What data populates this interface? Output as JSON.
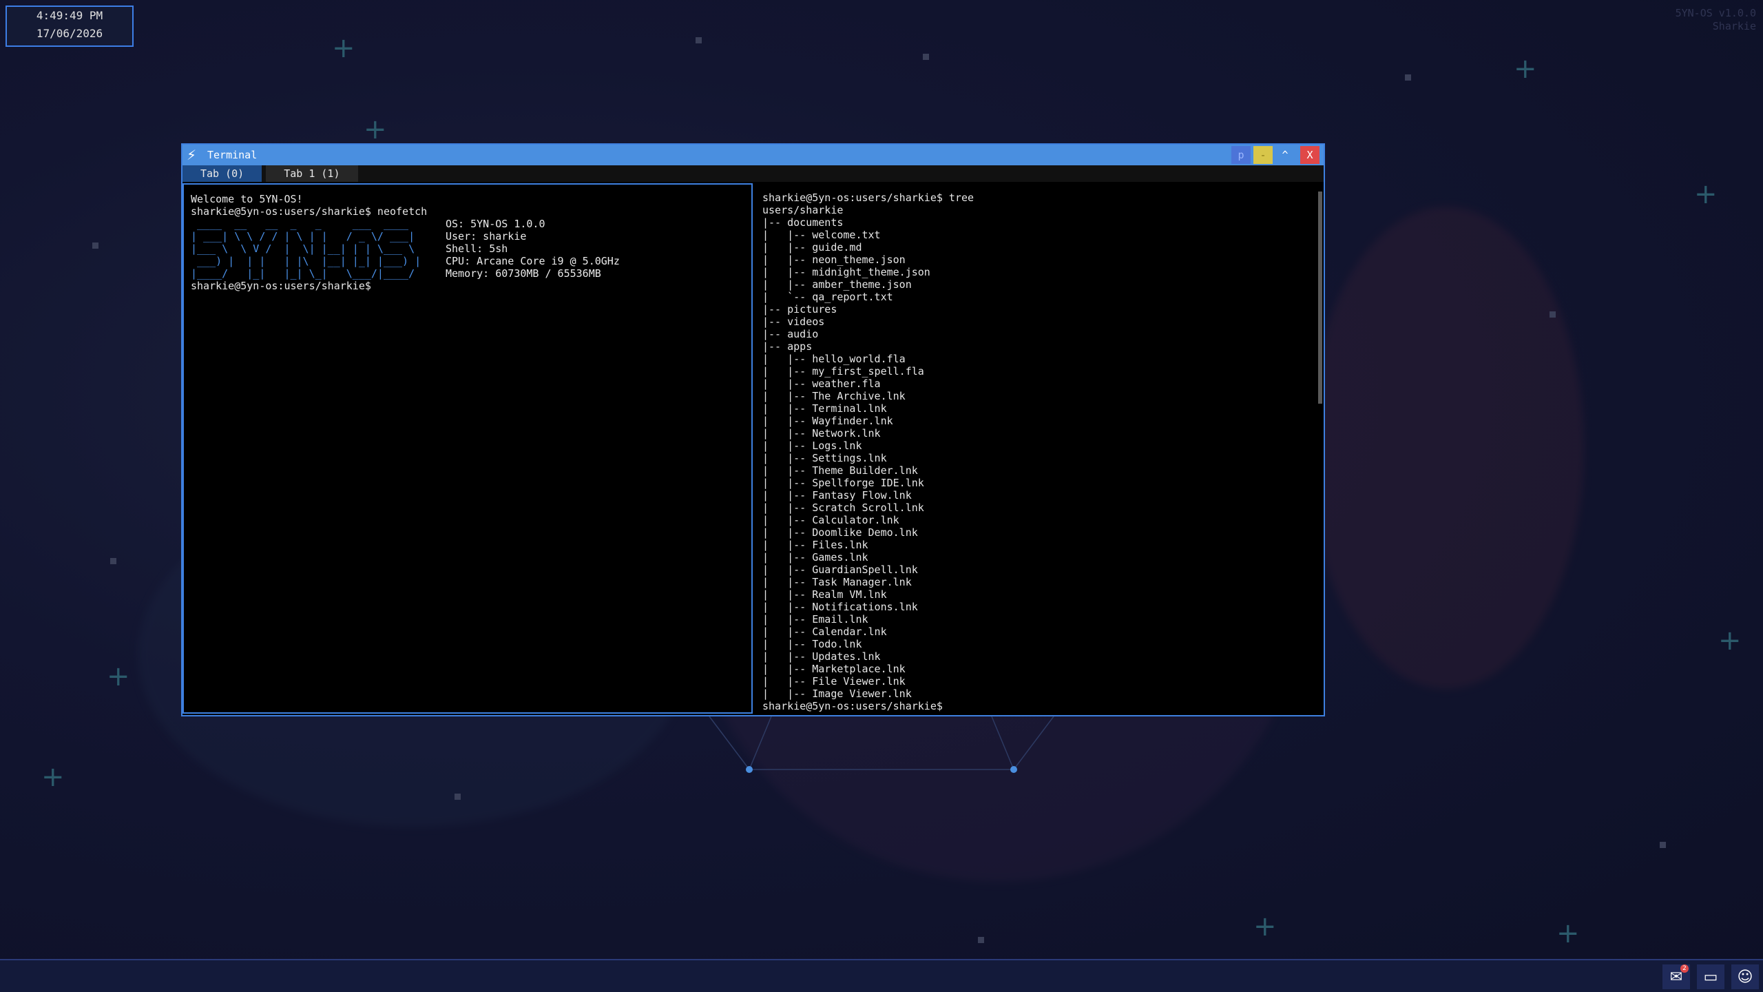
{
  "clock": {
    "time": "4:49:49 PM",
    "date": "17/06/2026"
  },
  "system": {
    "version": "5YN-OS v1.0.0",
    "user": "Sharkie"
  },
  "window": {
    "title": "Terminal",
    "icon": "lightning-icon",
    "buttons": {
      "p": "p",
      "minimize": "-",
      "maximize": "^",
      "close": "X"
    },
    "tabs": [
      {
        "label": "Tab (0)",
        "active": true
      },
      {
        "label": "Tab 1 (1)",
        "active": false
      }
    ]
  },
  "left_pane": {
    "welcome": "Welcome to 5YN-OS!",
    "command": "sharkie@5yn-os:users/sharkie$ neofetch",
    "ascii_art": [
      " ____  __   __  _   _     ___  ____",
      "| ___| \\ \\ / / | \\ | |   / _ \\/ ___|",
      "|___ \\  \\ V /  |  \\| |__| | | \\___ \\",
      " ___) |  | |   | |\\  |__| |_| |___) |",
      "|____/   |_|   |_| \\_|   \\___/|____/"
    ],
    "info": [
      "OS: 5YN-OS 1.0.0",
      "User: sharkie",
      "Shell: 5sh",
      "CPU: Arcane Core i9 @ 5.0GHz",
      "Memory: 60730MB / 65536MB"
    ],
    "prompt": "sharkie@5yn-os:users/sharkie$"
  },
  "right_pane": {
    "lines": [
      "sharkie@5yn-os:users/sharkie$ tree",
      "users/sharkie",
      "|-- documents",
      "|   |-- welcome.txt",
      "|   |-- guide.md",
      "|   |-- neon_theme.json",
      "|   |-- midnight_theme.json",
      "|   |-- amber_theme.json",
      "|   `-- qa_report.txt",
      "|-- pictures",
      "|-- videos",
      "|-- audio",
      "|-- apps",
      "|   |-- hello_world.fla",
      "|   |-- my_first_spell.fla",
      "|   |-- weather.fla",
      "|   |-- The Archive.lnk",
      "|   |-- Terminal.lnk",
      "|   |-- Wayfinder.lnk",
      "|   |-- Network.lnk",
      "|   |-- Logs.lnk",
      "|   |-- Settings.lnk",
      "|   |-- Theme Builder.lnk",
      "|   |-- Spellforge IDE.lnk",
      "|   |-- Fantasy Flow.lnk",
      "|   |-- Scratch Scroll.lnk",
      "|   |-- Calculator.lnk",
      "|   |-- Doomlike Demo.lnk",
      "|   |-- Files.lnk",
      "|   |-- Games.lnk",
      "|   |-- GuardianSpell.lnk",
      "|   |-- Task Manager.lnk",
      "|   |-- Realm VM.lnk",
      "|   |-- Notifications.lnk",
      "|   |-- Email.lnk",
      "|   |-- Calendar.lnk",
      "|   |-- Todo.lnk",
      "|   |-- Updates.lnk",
      "|   |-- Marketplace.lnk",
      "|   |-- File Viewer.lnk",
      "|   |-- Image Viewer.lnk",
      "sharkie@5yn-os:users/sharkie$"
    ]
  },
  "taskbar": {
    "tray": [
      {
        "name": "chat-icon",
        "badge": "2"
      },
      {
        "name": "window-icon"
      },
      {
        "name": "discord-icon"
      }
    ]
  },
  "colors": {
    "accent": "#4a8fe0",
    "minimize": "#d8c64a",
    "close": "#e04848",
    "background": "#121530"
  }
}
